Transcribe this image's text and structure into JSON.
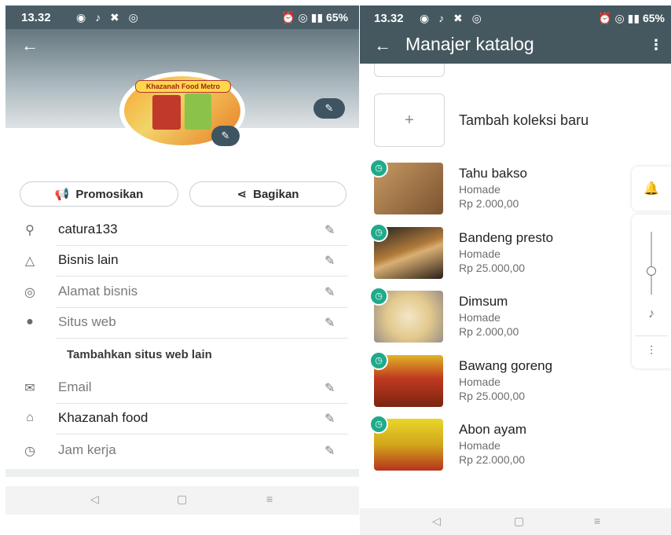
{
  "left": {
    "status": {
      "time": "13.32",
      "battery": "65%"
    },
    "profile_logo_text": "Khazanah Food Metro",
    "buttons": {
      "promote": "Promosikan",
      "share": "Bagikan"
    },
    "rows": [
      {
        "text": "catura133",
        "icon": "person-icon",
        "muted": false
      },
      {
        "text": "Bisnis lain",
        "icon": "shapes-icon",
        "muted": false
      },
      {
        "text": "Alamat bisnis",
        "icon": "location-icon",
        "muted": true
      },
      {
        "text": "Situs web",
        "icon": "globe-icon",
        "muted": true
      }
    ],
    "add_website": "Tambahkan situs web lain",
    "rows2": [
      {
        "text": "Email",
        "icon": "mail-icon",
        "muted": true
      },
      {
        "text": "Khazanah food",
        "icon": "store-icon",
        "muted": false
      },
      {
        "text": "Jam kerja",
        "icon": "clock-icon",
        "muted": true
      }
    ]
  },
  "right": {
    "status": {
      "time": "13.32",
      "battery": "65%"
    },
    "title": "Manajer katalog",
    "add_collection": "Tambah koleksi baru",
    "items": [
      {
        "name": "Tahu bakso",
        "sub": "Homade",
        "price": "Rp 2.000,00",
        "color": "#a0784a"
      },
      {
        "name": "Bandeng presto",
        "sub": "Homade",
        "price": "Rp 25.000,00",
        "color": "#3b2a1e"
      },
      {
        "name": "Dimsum",
        "sub": "Homade",
        "price": "Rp 2.000,00",
        "color": "#e7dcc4"
      },
      {
        "name": "Bawang goreng",
        "sub": "Homade",
        "price": "Rp 25.000,00",
        "color": "#d9a21b"
      },
      {
        "name": "Abon ayam",
        "sub": "Homade",
        "price": "Rp 22.000,00",
        "color": "#d8c51f"
      }
    ]
  },
  "colors": {
    "accent": "#1faa8b",
    "appbar": "#45585f"
  }
}
